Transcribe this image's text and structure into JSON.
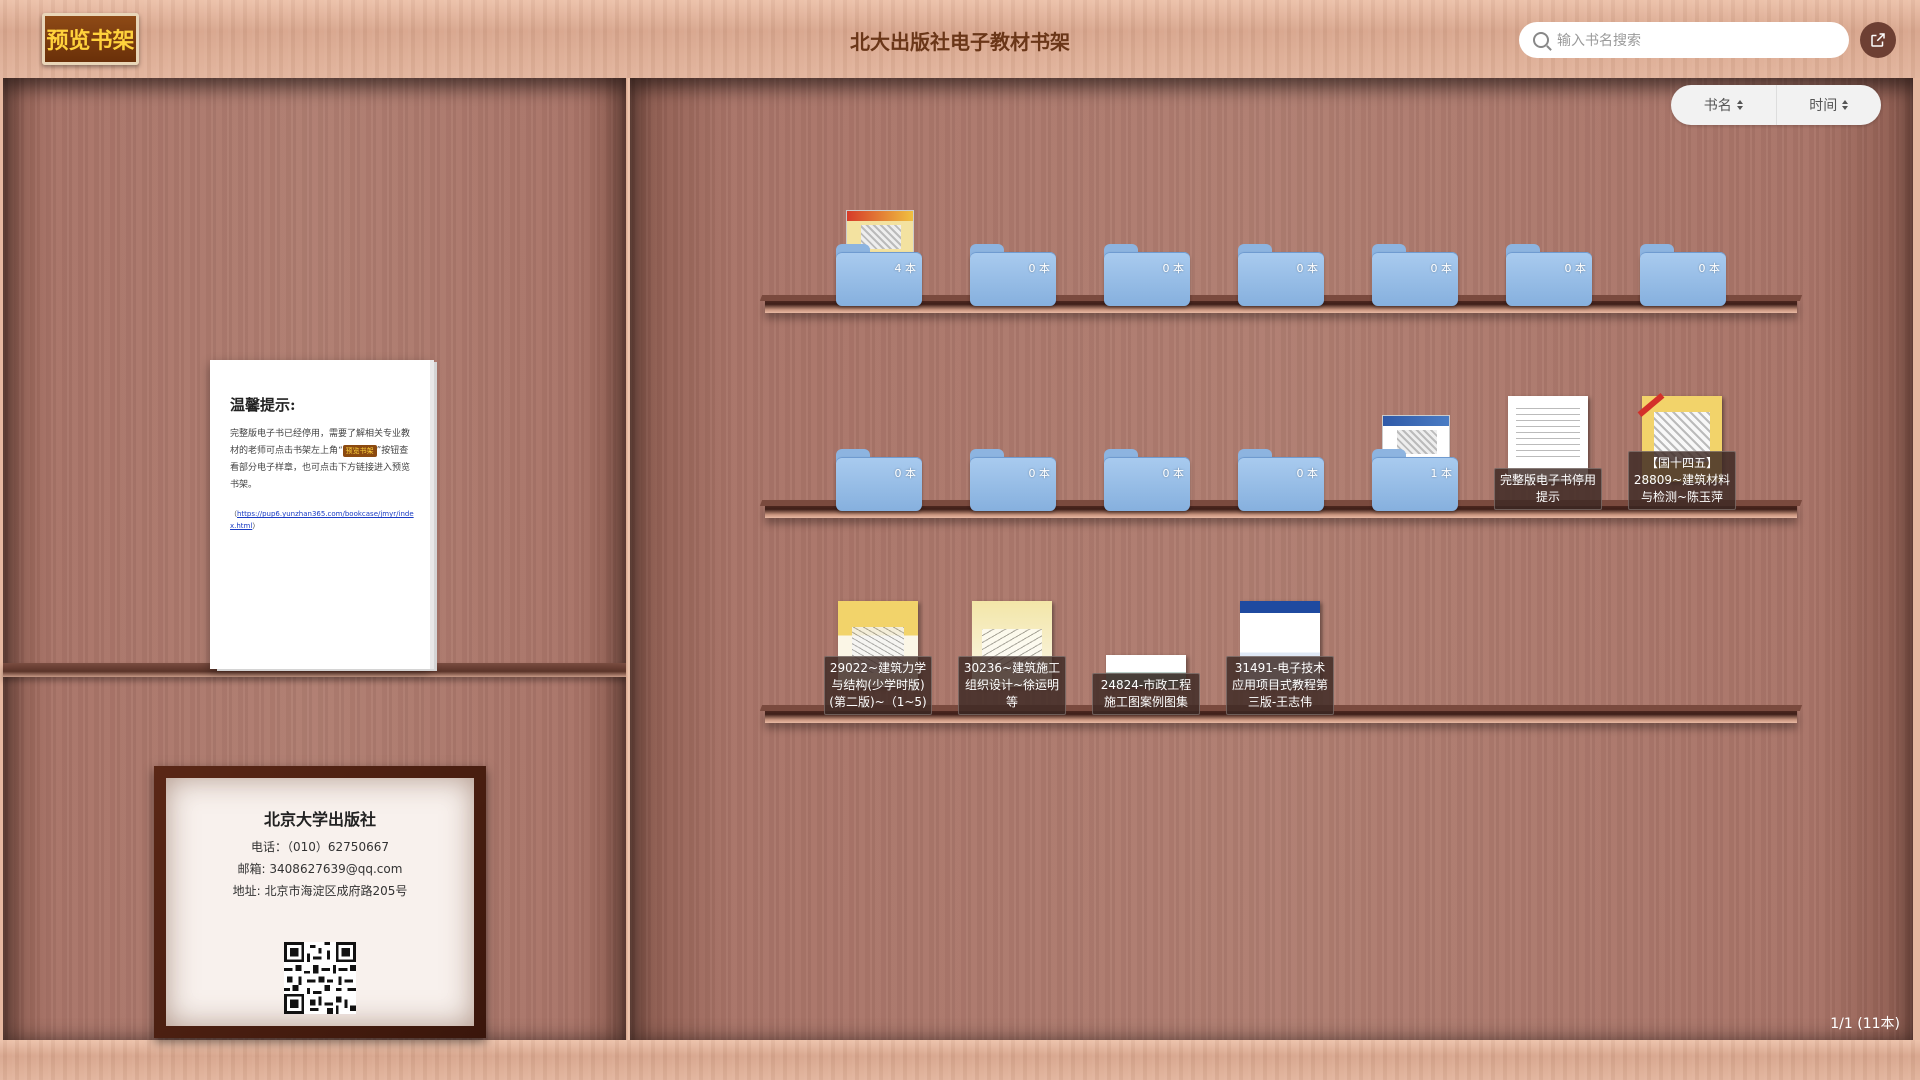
{
  "header": {
    "preview_button": "预览书架",
    "title": "北大出版社电子教材书架",
    "search_placeholder": "输入书名搜索",
    "export_icon": "external-link-icon"
  },
  "sort": {
    "by_name": "书名",
    "by_time": "时间"
  },
  "notice": {
    "title": "温馨提示:",
    "text_before": "完整版电子书已经停用，需要了解相关专业教材的老师可点击书架左上角“",
    "tag": "预览书架",
    "text_after": "”按钮查看部分电子样章，也可点击下方链接进入预览书架。",
    "link_prefix": "（",
    "link": "https://pup6.yunzhan365.com/bookcase/jmyr/index.html",
    "link_suffix": "）"
  },
  "contact": {
    "org": "北京大学出版社",
    "phone": "电话：（010）62750667",
    "email": "邮箱: 3408627639@qq.com",
    "address": "地址: 北京市海淀区成府路205号"
  },
  "shelf1_folders": [
    "4 本",
    "0 本",
    "0 本",
    "0 本",
    "0 本",
    "0 本",
    "0 本"
  ],
  "shelf2_folders": [
    "0 本",
    "0 本",
    "0 本",
    "0 本",
    "1 本"
  ],
  "shelf2_books": [
    {
      "title": "完整版电子书停用提示"
    },
    {
      "title": "【国十四五】28809~建筑材料与检测~陈玉萍"
    }
  ],
  "shelf3_books": [
    {
      "title": "29022~建筑力学与结构(少学时版)(第二版)~（1~5)"
    },
    {
      "title": "30236~建筑施工组织设计~徐运明等"
    },
    {
      "title": "24824-市政工程施工图案例图集"
    },
    {
      "title": "31491-电子技术应用项目式教程第三版-王志伟"
    }
  ],
  "pagination": "1/1 (11本)"
}
